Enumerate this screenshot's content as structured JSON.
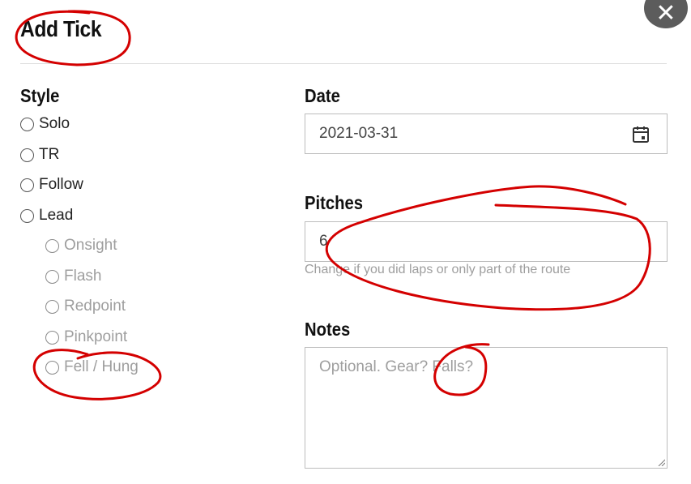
{
  "dialog": {
    "title": "Add Tick",
    "close_icon": "close-icon",
    "close_glyph": "✕"
  },
  "style": {
    "label": "Style",
    "options": [
      {
        "label": "Solo",
        "enabled": true
      },
      {
        "label": "TR",
        "enabled": true
      },
      {
        "label": "Follow",
        "enabled": true
      },
      {
        "label": "Lead",
        "enabled": true
      }
    ],
    "lead_sub_options": [
      {
        "label": "Onsight",
        "enabled": false
      },
      {
        "label": "Flash",
        "enabled": false
      },
      {
        "label": "Redpoint",
        "enabled": false
      },
      {
        "label": "Pinkpoint",
        "enabled": false
      },
      {
        "label": "Fell / Hung",
        "enabled": false
      }
    ]
  },
  "date": {
    "label": "Date",
    "value": "2021-03-31",
    "icon": "calendar-icon"
  },
  "pitches": {
    "label": "Pitches",
    "value": "6",
    "hint": "Change if you did laps or only part of the route"
  },
  "notes": {
    "label": "Notes",
    "placeholder": "Optional. Gear? Falls?",
    "value": ""
  },
  "colors": {
    "annotation_red": "#d40000",
    "close_button_bg": "#5c5c5c",
    "disabled_text": "#9e9e9e"
  }
}
